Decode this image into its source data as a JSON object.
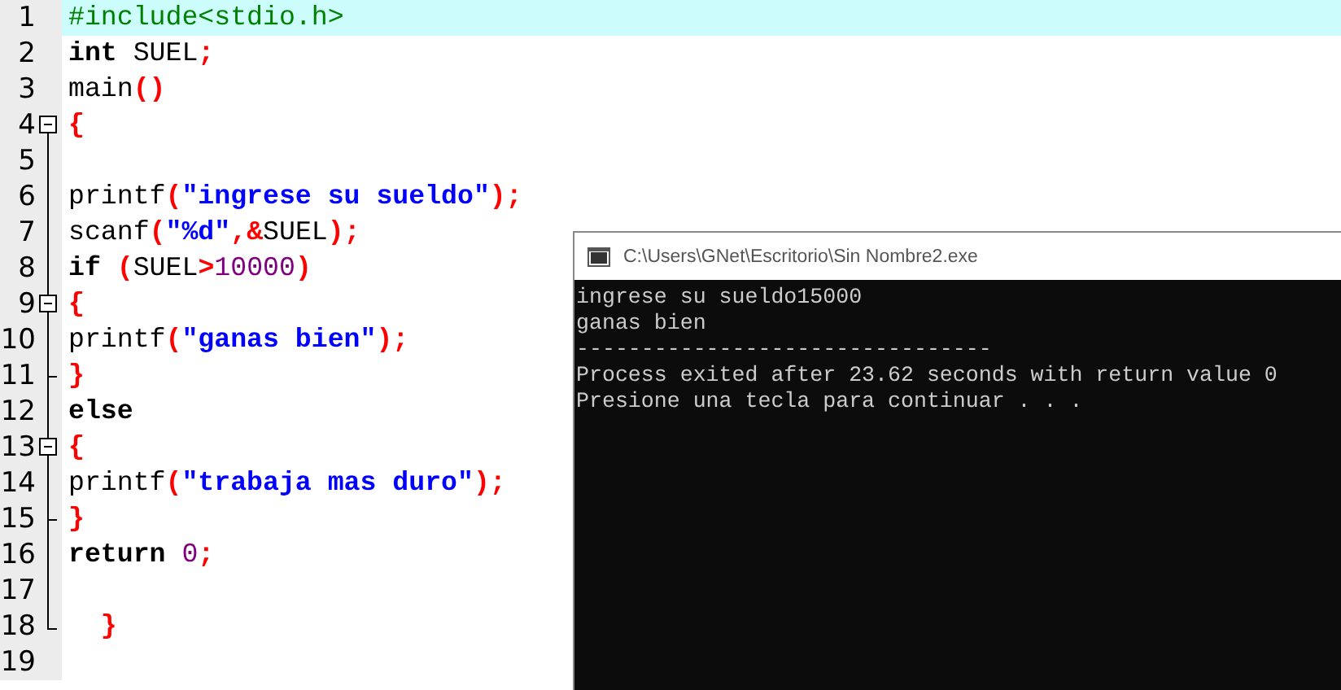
{
  "editor": {
    "lines": [
      {
        "number": "1",
        "current": true,
        "collapsible": false,
        "block_end": false,
        "tokens": [
          {
            "text": "#include<stdio.h>",
            "kind": "preproc"
          }
        ]
      },
      {
        "number": "2",
        "current": false,
        "collapsible": false,
        "block_end": false,
        "tokens": [
          {
            "text": "int",
            "kind": "keyword"
          },
          {
            "text": " SUEL",
            "kind": "plain"
          },
          {
            "text": ";",
            "kind": "symbol"
          }
        ]
      },
      {
        "number": "3",
        "current": false,
        "collapsible": false,
        "block_end": false,
        "tokens": [
          {
            "text": "main",
            "kind": "plain"
          },
          {
            "text": "()",
            "kind": "symbol"
          }
        ]
      },
      {
        "number": "4",
        "current": false,
        "collapsible": true,
        "block_end": false,
        "tokens": [
          {
            "text": "{",
            "kind": "symbol"
          }
        ]
      },
      {
        "number": "5",
        "current": false,
        "collapsible": false,
        "block_end": false
      },
      {
        "number": "6",
        "current": false,
        "collapsible": false,
        "block_end": false,
        "tokens": [
          {
            "text": "printf",
            "kind": "plain"
          },
          {
            "text": "(",
            "kind": "symbol"
          },
          {
            "text": "\"ingrese su sueldo\"",
            "kind": "string"
          },
          {
            "text": ");",
            "kind": "symbol"
          }
        ]
      },
      {
        "number": "7",
        "current": false,
        "collapsible": false,
        "block_end": false,
        "tokens": [
          {
            "text": "scanf",
            "kind": "plain"
          },
          {
            "text": "(",
            "kind": "symbol"
          },
          {
            "text": "\"%d\"",
            "kind": "string"
          },
          {
            "text": ",&",
            "kind": "symbol"
          },
          {
            "text": "SUEL",
            "kind": "plain"
          },
          {
            "text": ");",
            "kind": "symbol"
          }
        ]
      },
      {
        "number": "8",
        "current": false,
        "collapsible": false,
        "block_end": false,
        "tokens": [
          {
            "text": "if",
            "kind": "keyword"
          },
          {
            "text": " (",
            "kind": "symbol"
          },
          {
            "text": "SUEL",
            "kind": "plain"
          },
          {
            "text": ">",
            "kind": "symbol"
          },
          {
            "text": "10000",
            "kind": "number"
          },
          {
            "text": ")",
            "kind": "symbol"
          }
        ]
      },
      {
        "number": "9",
        "current": false,
        "collapsible": true,
        "block_end": false,
        "tokens": [
          {
            "text": "{",
            "kind": "symbol"
          }
        ]
      },
      {
        "number": "10",
        "current": false,
        "collapsible": false,
        "block_end": false,
        "tokens": [
          {
            "text": "printf",
            "kind": "plain"
          },
          {
            "text": "(",
            "kind": "symbol"
          },
          {
            "text": "\"ganas bien\"",
            "kind": "string"
          },
          {
            "text": ");",
            "kind": "symbol"
          }
        ]
      },
      {
        "number": "11",
        "current": false,
        "collapsible": false,
        "block_end": true,
        "tokens": [
          {
            "text": "}",
            "kind": "symbol"
          }
        ]
      },
      {
        "number": "12",
        "current": false,
        "collapsible": false,
        "block_end": false,
        "tokens": [
          {
            "text": "else",
            "kind": "keyword"
          }
        ]
      },
      {
        "number": "13",
        "current": false,
        "collapsible": true,
        "block_end": false,
        "tokens": [
          {
            "text": "{",
            "kind": "symbol"
          }
        ]
      },
      {
        "number": "14",
        "current": false,
        "collapsible": false,
        "block_end": false,
        "tokens": [
          {
            "text": "printf",
            "kind": "plain"
          },
          {
            "text": "(",
            "kind": "symbol"
          },
          {
            "text": "\"trabaja mas duro\"",
            "kind": "string"
          },
          {
            "text": ");",
            "kind": "symbol"
          }
        ]
      },
      {
        "number": "15",
        "current": false,
        "collapsible": false,
        "block_end": true,
        "tokens": [
          {
            "text": "}",
            "kind": "symbol"
          }
        ]
      },
      {
        "number": "16",
        "current": false,
        "collapsible": false,
        "block_end": false,
        "tokens": [
          {
            "text": "return",
            "kind": "keyword"
          },
          {
            "text": " 0",
            "kind": "number"
          },
          {
            "text": ";",
            "kind": "symbol"
          }
        ]
      },
      {
        "number": "17",
        "current": false,
        "collapsible": false,
        "block_end": false
      },
      {
        "number": "18",
        "current": false,
        "collapsible": false,
        "block_end": true,
        "tokens": [
          {
            "text": "  }",
            "kind": "symbol"
          }
        ]
      },
      {
        "number": "19",
        "current": false,
        "collapsible": false,
        "block_end": false
      }
    ]
  },
  "console": {
    "title": "C:\\Users\\GNet\\Escritorio\\Sin Nombre2.exe",
    "output": [
      "ingrese su sueldo15000",
      "ganas bien",
      "--------------------------------",
      "Process exited after 23.62 seconds with return value 0",
      "Presione una tecla para continuar . . ."
    ]
  }
}
